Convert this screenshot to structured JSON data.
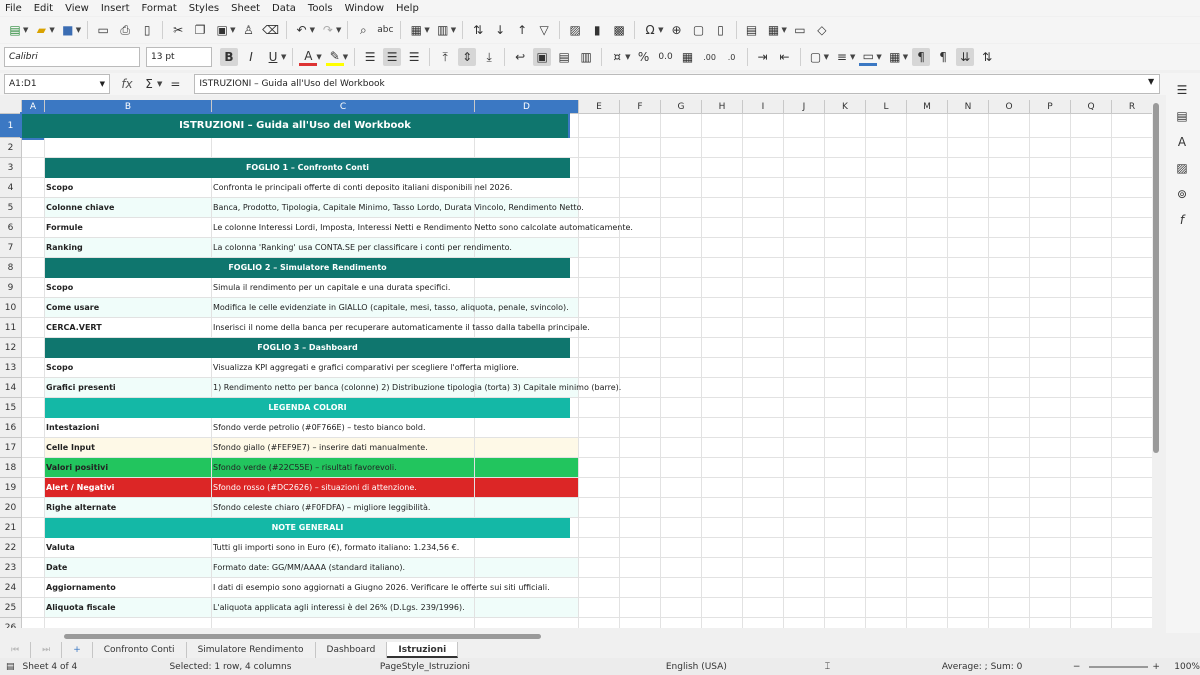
{
  "menu": [
    "File",
    "Edit",
    "View",
    "Insert",
    "Format",
    "Styles",
    "Sheet",
    "Data",
    "Tools",
    "Window",
    "Help"
  ],
  "toolbar": {
    "font_name": "Calibri",
    "font_size": "13 pt",
    "bold": "B",
    "italic": "I",
    "underline": "U",
    "percent": "%",
    "decimals": "0.0",
    "decimals_add": ".00",
    "decimals_remove": ".0"
  },
  "formula_bar": {
    "name_box": "A1:D1",
    "fx": "fx",
    "sum": "Σ",
    "equals": "=",
    "content": "ISTRUZIONI – Guida all'Uso del Workbook"
  },
  "columns": [
    {
      "label": "A",
      "sel": true
    },
    {
      "label": "B",
      "sel": true
    },
    {
      "label": "C",
      "sel": true
    },
    {
      "label": "D",
      "sel": true
    },
    {
      "label": "E",
      "sel": false
    },
    {
      "label": "F",
      "sel": false
    },
    {
      "label": "G",
      "sel": false
    },
    {
      "label": "H",
      "sel": false
    },
    {
      "label": "I",
      "sel": false
    },
    {
      "label": "J",
      "sel": false
    },
    {
      "label": "K",
      "sel": false
    },
    {
      "label": "L",
      "sel": false
    },
    {
      "label": "M",
      "sel": false
    },
    {
      "label": "N",
      "sel": false
    },
    {
      "label": "O",
      "sel": false
    },
    {
      "label": "P",
      "sel": false
    },
    {
      "label": "Q",
      "sel": false
    },
    {
      "label": "R",
      "sel": false
    }
  ],
  "colors": {
    "teal_dark": "#0F766E",
    "teal_light": "#14B8A6",
    "light_row": "#F0FDFA",
    "yellow": "#FEF9E7",
    "green": "#22C55E",
    "red": "#DC2626"
  },
  "rows": [
    {
      "n": "1",
      "type": "title",
      "text": "ISTRUZIONI – Guida all'Uso del Workbook"
    },
    {
      "n": "2",
      "type": "empty"
    },
    {
      "n": "3",
      "type": "header",
      "text": "FOGLIO 1 – Confronto Conti"
    },
    {
      "n": "4",
      "type": "item",
      "label": "Scopo",
      "text": "Confronta le principali offerte di conti deposito italiani disponibili nel 2026.",
      "bg": "white"
    },
    {
      "n": "5",
      "type": "item",
      "label": "Colonne chiave",
      "text": "Banca, Prodotto, Tipologia, Capitale Minimo, Tasso Lordo, Durata Vincolo, Rendimento Netto.",
      "bg": "light"
    },
    {
      "n": "6",
      "type": "item",
      "label": "Formule",
      "text": "Le colonne Interessi Lordi, Imposta, Interessi Netti e Rendimento Netto sono calcolate automaticamente.",
      "bg": "white"
    },
    {
      "n": "7",
      "type": "item",
      "label": "Ranking",
      "text": "La colonna 'Ranking' usa CONTA.SE per classificare i conti per rendimento.",
      "bg": "light"
    },
    {
      "n": "8",
      "type": "header",
      "text": "FOGLIO 2 – Simulatore Rendimento"
    },
    {
      "n": "9",
      "type": "item",
      "label": "Scopo",
      "text": "Simula il rendimento per un capitale e una durata specifici.",
      "bg": "white"
    },
    {
      "n": "10",
      "type": "item",
      "label": "Come usare",
      "text": "Modifica le celle evidenziate in GIALLO (capitale, mesi, tasso, aliquota, penale, svincolo).",
      "bg": "light"
    },
    {
      "n": "11",
      "type": "item",
      "label": "CERCA.VERT",
      "text": "Inserisci il nome della banca per recuperare automaticamente il tasso dalla tabella principale.",
      "bg": "white"
    },
    {
      "n": "12",
      "type": "header",
      "text": "FOGLIO 3 – Dashboard"
    },
    {
      "n": "13",
      "type": "item",
      "label": "Scopo",
      "text": "Visualizza KPI aggregati e grafici comparativi per scegliere l'offerta migliore.",
      "bg": "white"
    },
    {
      "n": "14",
      "type": "item",
      "label": "Grafici presenti",
      "text": "1) Rendimento netto per banca (colonne)  2) Distribuzione tipologia (torta)  3) Capitale minimo (barre).",
      "bg": "light"
    },
    {
      "n": "15",
      "type": "subheader",
      "text": "LEGENDA COLORI"
    },
    {
      "n": "16",
      "type": "item",
      "label": "Intestazioni",
      "text": "Sfondo verde petrolio (#0F766E) – testo bianco bold.",
      "bg": "white"
    },
    {
      "n": "17",
      "type": "item",
      "label": "Celle Input",
      "text": "Sfondo giallo (#FEF9E7) – inserire dati manualmente.",
      "bg": "yellow"
    },
    {
      "n": "18",
      "type": "item",
      "label": "Valori positivi",
      "text": "Sfondo verde (#22C55E) – risultati favorevoli.",
      "bg": "green"
    },
    {
      "n": "19",
      "type": "item",
      "label": "Alert / Negativi",
      "text": "Sfondo rosso (#DC2626) – situazioni di attenzione.",
      "bg": "red"
    },
    {
      "n": "20",
      "type": "item",
      "label": "Righe alternate",
      "text": "Sfondo celeste chiaro (#F0FDFA) – migliore leggibilità.",
      "bg": "light"
    },
    {
      "n": "21",
      "type": "subheader",
      "text": "NOTE GENERALI"
    },
    {
      "n": "22",
      "type": "item",
      "label": "Valuta",
      "text": "Tutti gli importi sono in Euro (€), formato italiano: 1.234,56 €.",
      "bg": "white"
    },
    {
      "n": "23",
      "type": "item",
      "label": "Date",
      "text": "Formato date: GG/MM/AAAA (standard italiano).",
      "bg": "light"
    },
    {
      "n": "24",
      "type": "item",
      "label": "Aggiornamento",
      "text": "I dati di esempio sono aggiornati a Giugno 2026. Verificare le offerte sui siti ufficiali.",
      "bg": "white"
    },
    {
      "n": "25",
      "type": "item",
      "label": "Aliquota fiscale",
      "text": "L'aliquota applicata agli interessi è del 26% (D.Lgs. 239/1996).",
      "bg": "light"
    },
    {
      "n": "26",
      "type": "empty"
    }
  ],
  "tabs": [
    "Confronto Conti",
    "Simulatore Rendimento",
    "Dashboard",
    "Istruzioni"
  ],
  "status": {
    "sheet": "Sheet 4 of 4",
    "selection": "Selected: 1 row, 4 columns",
    "page_style": "PageStyle_Istruzioni",
    "language": "English (USA)",
    "sum": "Average: ; Sum: 0",
    "zoom": "100%"
  }
}
